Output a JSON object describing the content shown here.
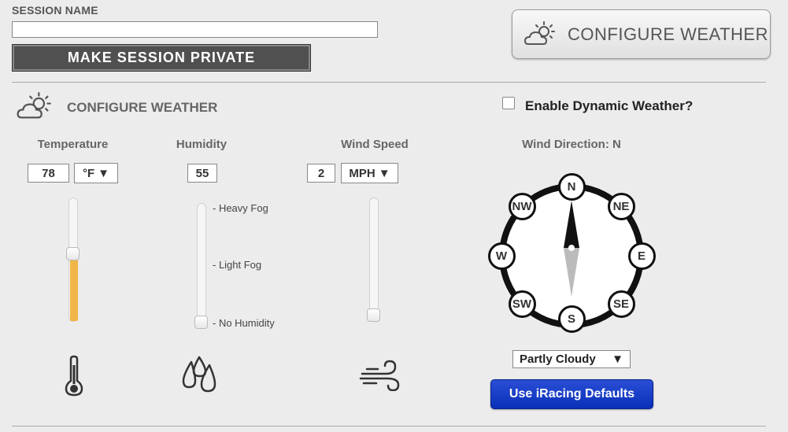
{
  "session": {
    "label": "SESSION NAME",
    "name_value": "",
    "private_button": "MAKE SESSION PRIVATE"
  },
  "top_button": {
    "label": "CONFIGURE WEATHER"
  },
  "section": {
    "title": "CONFIGURE WEATHER",
    "dynamic_label": "Enable Dynamic Weather?",
    "dynamic_checked": false
  },
  "temperature": {
    "heading": "Temperature",
    "value": "78",
    "unit": "°F",
    "slider_level": 0.55
  },
  "humidity": {
    "heading": "Humidity",
    "value": "55",
    "levels": [
      "- Heavy Fog",
      "- Light Fog",
      "- No Humidity"
    ],
    "slider_level": 0.0
  },
  "wind_speed": {
    "heading": "Wind Speed",
    "value": "2",
    "unit": "MPH",
    "slider_level": 0.0
  },
  "wind_direction": {
    "heading": "Wind Direction: N",
    "directions": [
      "N",
      "NE",
      "E",
      "SE",
      "S",
      "SW",
      "W",
      "NW"
    ],
    "selected": "N"
  },
  "sky": {
    "selected": "Partly Cloudy"
  },
  "defaults_button": "Use iRacing Defaults",
  "dropdown_arrow": "▼",
  "icons": {
    "weather": "partly-cloudy-icon",
    "thermometer": "thermometer-icon",
    "drops": "water-drops-icon",
    "wind": "wind-icon"
  },
  "colors": {
    "slider_fill": "#f2b548",
    "defaults_button": "#1a3fc8"
  }
}
